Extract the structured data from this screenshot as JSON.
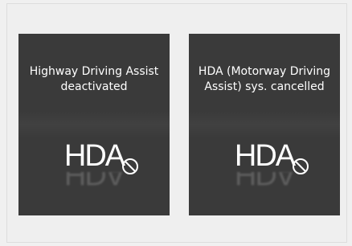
{
  "panels": [
    {
      "message": "Highway Driving Assist deactivated",
      "logo": "HDA",
      "status_icon": "prohibited-icon"
    },
    {
      "message": "HDA (Motorway Driving Assist) sys. cancelled",
      "logo": "HDA",
      "status_icon": "prohibited-icon"
    }
  ],
  "colors": {
    "page_background": "#f0f0f0",
    "panel_background": "#3a3a3a",
    "text": "#ffffff"
  }
}
